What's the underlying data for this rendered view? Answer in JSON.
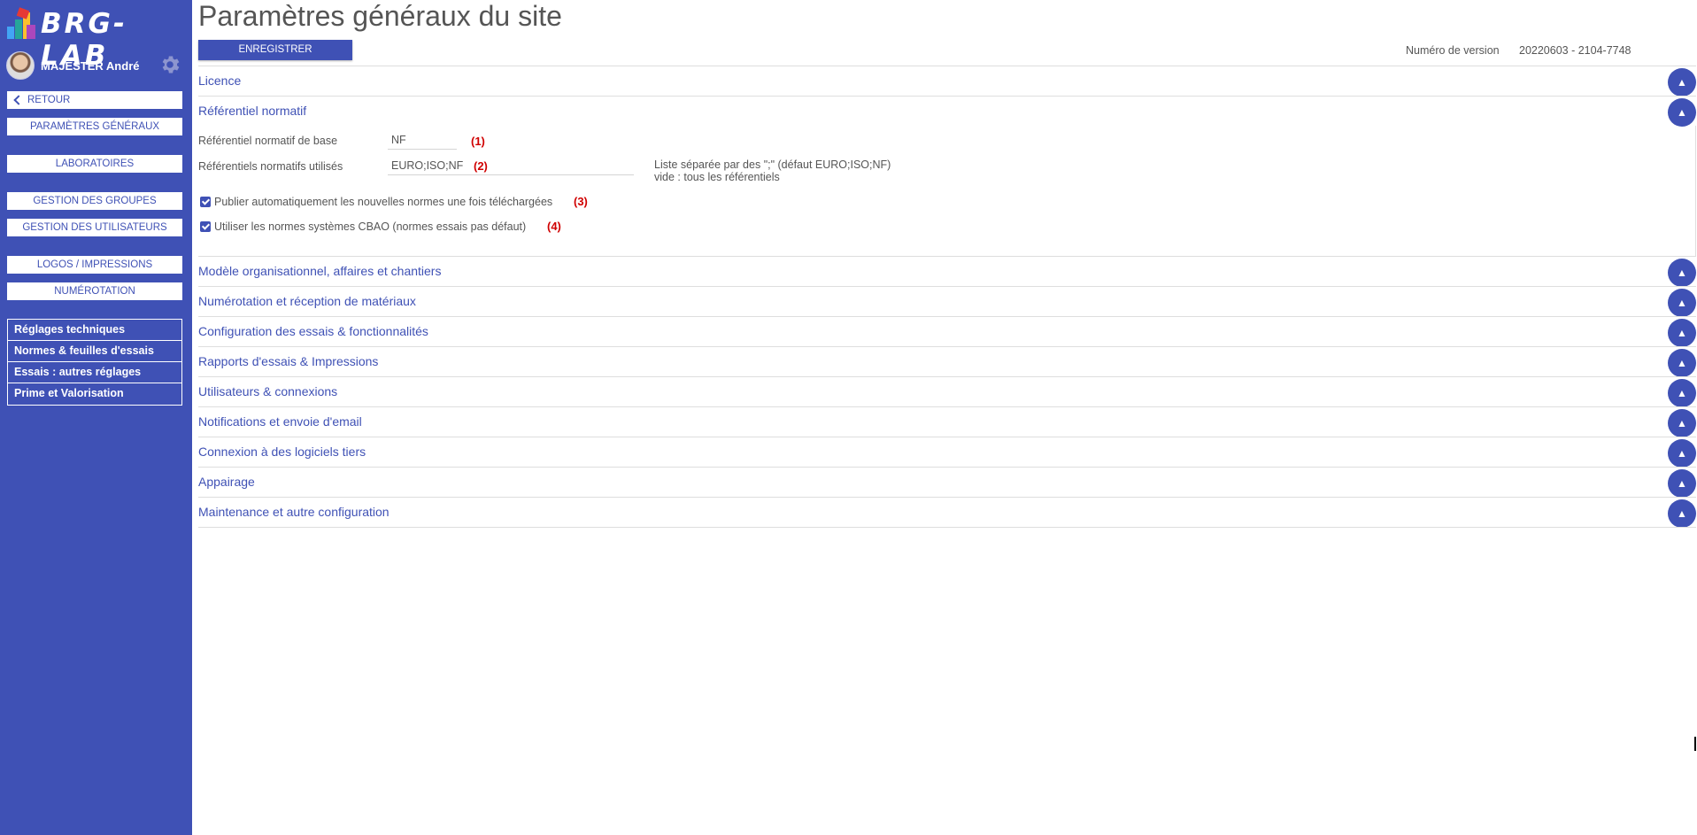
{
  "sidebar": {
    "logo_text": "BRG-LAB",
    "user_name": "MAJESTER André",
    "back_label": "RETOUR",
    "nav_buttons": [
      "PARAMÈTRES GÉNÉRAUX",
      "LABORATOIRES",
      "GESTION DES GROUPES",
      "GESTION DES UTILISATEURS",
      "LOGOS / IMPRESSIONS",
      "NUMÉROTATION"
    ],
    "links": [
      "Réglages techniques",
      "Normes & feuilles d'essais",
      "Essais : autres réglages",
      "Prime et Valorisation"
    ],
    "logo_colors": [
      "#e53935",
      "#fbc02d",
      "#26a69a",
      "#42a5f5",
      "#ab47bc"
    ]
  },
  "page": {
    "title": "Paramètres généraux du site",
    "save_label": "ENREGISTRER",
    "version_label": "Numéro de version",
    "version_value": "20220603 - 2104-7748"
  },
  "sections": [
    {
      "label": "Licence",
      "expanded": false
    },
    {
      "label": "Référentiel normatif",
      "expanded": true
    },
    {
      "label": "Modèle organisationnel, affaires et chantiers",
      "expanded": false
    },
    {
      "label": "Numérotation et réception de matériaux",
      "expanded": false
    },
    {
      "label": "Configuration des essais & fonctionnalités",
      "expanded": false
    },
    {
      "label": "Rapports d'essais & Impressions",
      "expanded": false
    },
    {
      "label": "Utilisateurs & connexions",
      "expanded": false
    },
    {
      "label": "Notifications et envoie d'email",
      "expanded": false
    },
    {
      "label": "Connexion à des logiciels tiers",
      "expanded": false
    },
    {
      "label": "Appairage",
      "expanded": false
    },
    {
      "label": "Maintenance et autre configuration",
      "expanded": false
    }
  ],
  "referentiel": {
    "base_label": "Référentiel normatif de base",
    "base_value": "NF",
    "base_note": "(1)",
    "used_label": "Référentiels normatifs utilisés",
    "used_value": "EURO;ISO;NF",
    "used_note": "(2)",
    "hint_line1": "Liste séparée par des \";\" (défaut EURO;ISO;NF)",
    "hint_line2": "vide : tous les référentiels",
    "check1_label": "Publier automatiquement les nouvelles normes une fois téléchargées",
    "check1_checked": true,
    "check1_note": "(3)",
    "check2_label": "Utiliser les normes systèmes CBAO (normes essais pas défaut)",
    "check2_checked": true,
    "check2_note": "(4)"
  },
  "toggle_icon": "▲",
  "accent_color": "#3f51b5",
  "note_color": "#d00000"
}
